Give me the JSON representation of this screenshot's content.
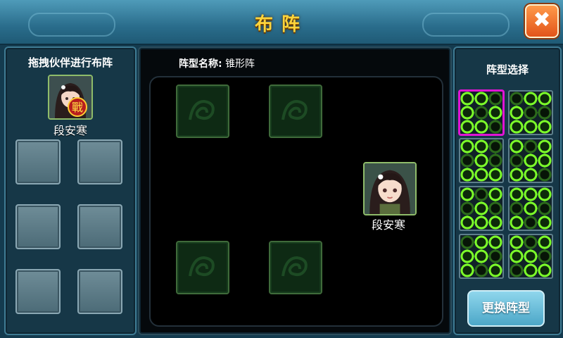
{
  "header": {
    "title": "布阵",
    "close_label": "✖"
  },
  "left_panel": {
    "title": "拖拽伙伴进行布阵",
    "partner": {
      "name": "段安寒",
      "badge": "戰"
    }
  },
  "middle_panel": {
    "formation_label": "阵型名称:",
    "formation_name": "锥形阵",
    "placed": {
      "name": "段安寒"
    }
  },
  "right_panel": {
    "title": "阵型选择",
    "button_label": "更换阵型",
    "selected_index": 0
  },
  "colors": {
    "title": "#ffd43a",
    "selection": "#e014d4",
    "node_active": "#7dff2a",
    "node_inactive": "#2c6b1c"
  }
}
